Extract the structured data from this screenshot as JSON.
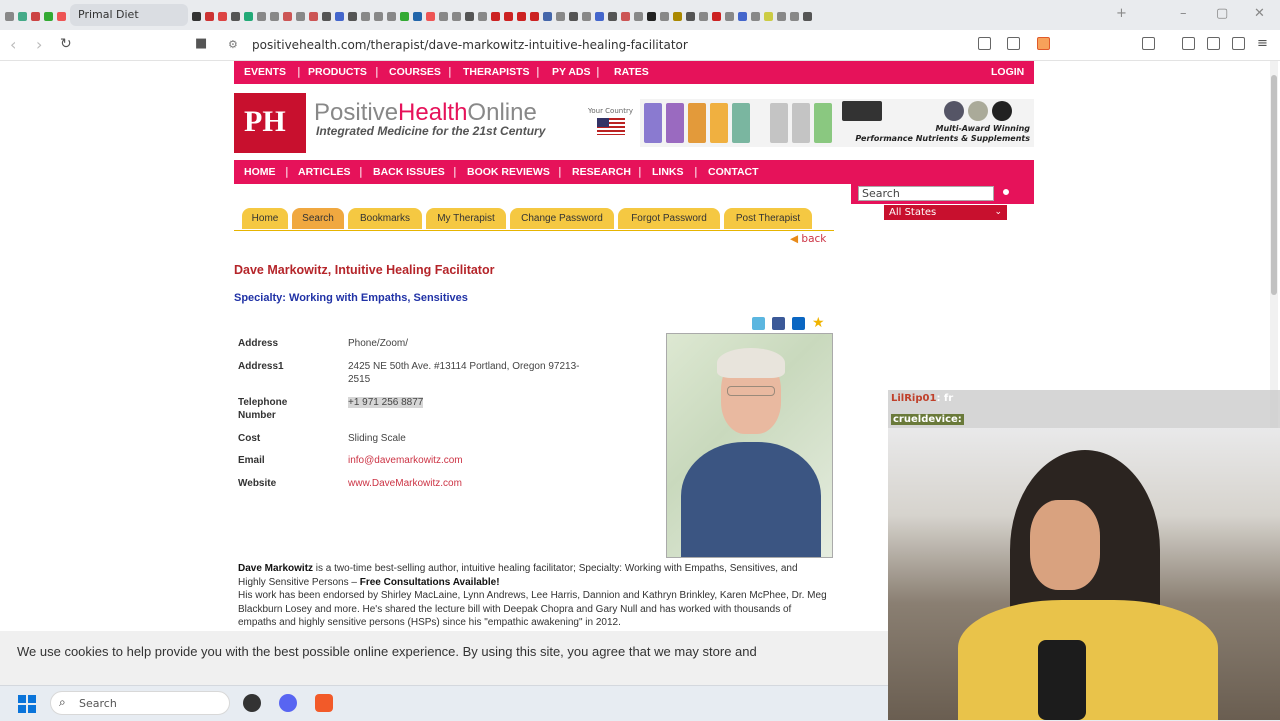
{
  "browser": {
    "active_tab": "Primal Diet Coaching",
    "url": "positivehealth.com/therapist/dave-markowitz-intuitive-healing-facilitator"
  },
  "site": {
    "top_nav": [
      "EVENTS",
      "PRODUCTS",
      "COURSES",
      "THERAPISTS",
      "PY ADS",
      "RATES"
    ],
    "login": "LOGIN",
    "brand_positive": "Positive",
    "brand_health": "Health",
    "brand_online": "Online",
    "tagline": "Integrated Medicine for the 21st Century",
    "your_country": "Your Country",
    "banner_text_1": "Multi-Award Winning",
    "banner_text_2": "Performance Nutrients & Supplements",
    "main_nav": [
      "HOME",
      "ARTICLES",
      "BACK ISSUES",
      "BOOK REVIEWS",
      "RESEARCH",
      "LINKS",
      "CONTACT"
    ],
    "search_placeholder": "Search",
    "states_selected": "All States",
    "page_tabs": [
      "Home",
      "Search",
      "Bookmarks",
      "My Therapist",
      "Change Password",
      "Forgot Password",
      "Post Therapist"
    ],
    "back_label": "back"
  },
  "therapist": {
    "title": "Dave Markowitz, Intuitive Healing Facilitator",
    "specialty": "Specialty: Working with Empaths, Sensitives",
    "fields": {
      "address_label": "Address",
      "address": "Phone/Zoom/",
      "address1_label": "Address1",
      "address1": "2425 NE 50th Ave. #13114 Portland, Oregon 97213-2515",
      "telephone_label": "Telephone Number",
      "telephone": "+1 971 256 8877",
      "cost_label": "Cost",
      "cost": "Sliding Scale",
      "email_label": "Email",
      "email": "info@davemarkowitz.com",
      "website_label": "Website",
      "website": "www.DaveMarkowitz.com"
    },
    "bio_name": "Dave Markowitz",
    "bio_1": " is a two-time best-selling author, intuitive healing facilitator; Specialty: Working with Empaths, Sensitives, and Highly Sensitive Persons – ",
    "bio_free": "Free Consultations Available!",
    "bio_2": "His work has been endorsed by Shirley MacLaine, Lynn Andrews, Lee Harris, Dannion and Kathryn Brinkley, Karen McPhee, Dr. Meg Blackburn Losey and more. He's shared the lecture bill with Deepak Chopra and Gary Null and has worked with thousands of empaths and highly sensitive persons (HSPs) since his \"empathic awakening\" in 2012."
  },
  "cookie_banner": "We use cookies to help provide you with the best possible online experience. By using this site, you agree that we may store and",
  "taskbar": {
    "search": "Search"
  },
  "stream": {
    "chat_user_1": "LilRip01",
    "chat_msg_1": ": fr",
    "chat_user_2": "crueldevice",
    "chat_msg_2": ":"
  }
}
